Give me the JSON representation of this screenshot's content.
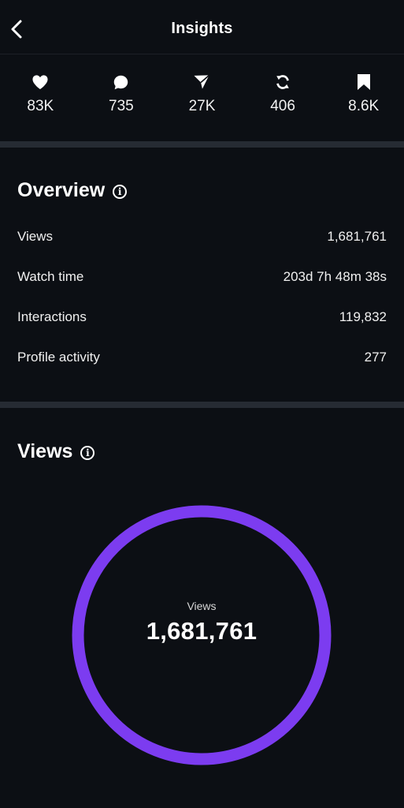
{
  "header": {
    "title": "Insights"
  },
  "stats": [
    {
      "icon": "heart-icon",
      "value": "83K"
    },
    {
      "icon": "comment-icon",
      "value": "735"
    },
    {
      "icon": "send-icon",
      "value": "27K"
    },
    {
      "icon": "repost-icon",
      "value": "406"
    },
    {
      "icon": "bookmark-icon",
      "value": "8.6K"
    }
  ],
  "overview": {
    "title": "Overview",
    "rows": [
      {
        "label": "Views",
        "value": "1,681,761"
      },
      {
        "label": "Watch time",
        "value": "203d 7h 48m 38s"
      },
      {
        "label": "Interactions",
        "value": "119,832"
      },
      {
        "label": "Profile activity",
        "value": "277"
      }
    ]
  },
  "views": {
    "title": "Views",
    "donut_label": "Views",
    "donut_value": "1,681,761",
    "ring_color": "#7c3cf0"
  }
}
